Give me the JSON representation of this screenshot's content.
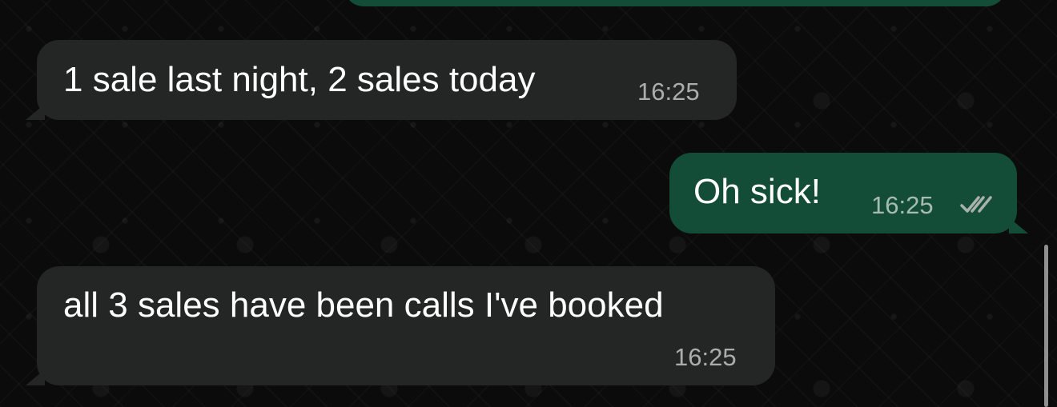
{
  "conversation": {
    "messages": [
      {
        "direction": "incoming",
        "text": "1 sale last night, 2 sales today",
        "time": "16:25"
      },
      {
        "direction": "outgoing",
        "text": "Oh sick!",
        "time": "16:25",
        "status_icon": "double-check-icon"
      },
      {
        "direction": "incoming",
        "text": "all 3 sales have been calls I've booked",
        "time": "16:25"
      }
    ]
  },
  "theme": {
    "background": "#0b0b0b",
    "incoming_bubble": "#242626",
    "outgoing_bubble": "#134d37",
    "text": "#ffffff",
    "meta_text": "#a1a1a1"
  }
}
